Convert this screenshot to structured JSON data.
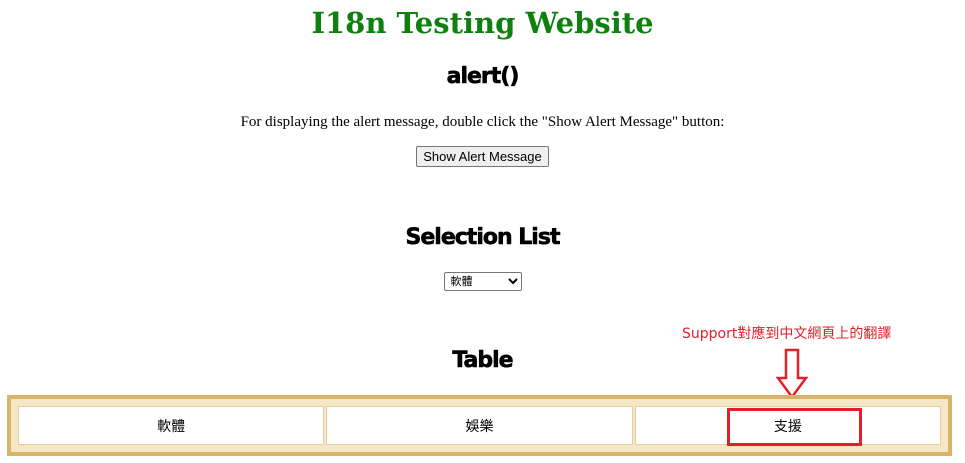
{
  "page": {
    "title": "I18n Testing Website"
  },
  "alert_section": {
    "heading": "alert()",
    "instruction": "For displaying the alert message, double click the \"Show Alert Message\" button:",
    "button_label": "Show Alert Message"
  },
  "selection_section": {
    "heading": "Selection List",
    "selected_option": "軟體"
  },
  "table_section": {
    "heading": "Table",
    "cells": [
      "軟體",
      "娛樂",
      "支援"
    ]
  },
  "annotation": {
    "text": "Support對應到中文網頁上的翻譯",
    "color": "#e3202a",
    "arrow_icon": "down-arrow-outline-icon"
  },
  "colors": {
    "title": "#0f800f",
    "table_border": "#d9b46a",
    "table_bg": "#f6e7c6"
  }
}
